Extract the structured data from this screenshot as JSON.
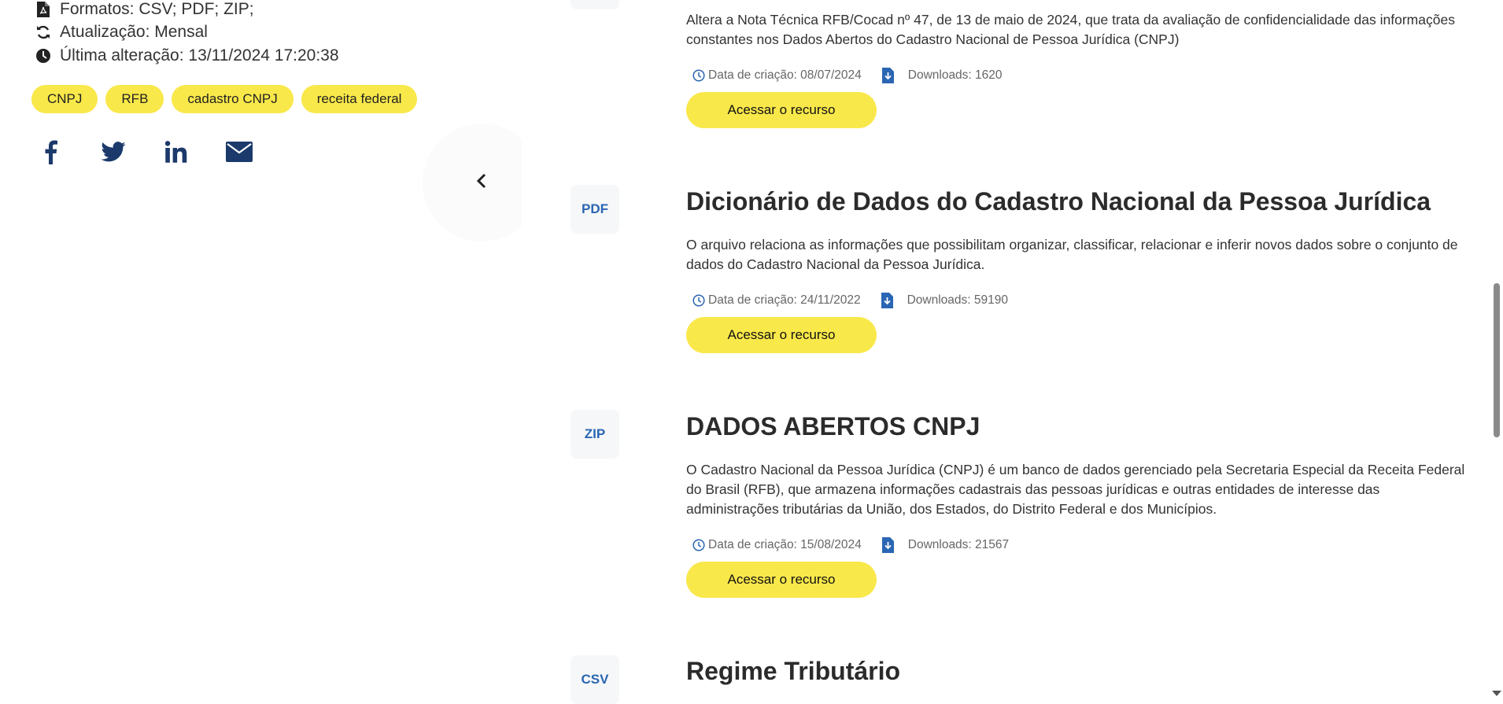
{
  "sidebar": {
    "formats": "Formatos: CSV; PDF; ZIP;",
    "update": "Atualização: Mensal",
    "last_change": "Última alteração: 13/11/2024 17:20:38",
    "tags": [
      "CNPJ",
      "RFB",
      "cadastro CNPJ",
      "receita federal"
    ],
    "social": [
      "facebook-icon",
      "twitter-icon",
      "linkedin-icon",
      "email-icon"
    ]
  },
  "resources": [
    {
      "format": "",
      "title": "",
      "description": "Altera a Nota Técnica RFB/Cocad nº 47, de 13 de maio de 2024, que trata da avaliação de confidencialidade das informações constantes nos Dados Abertos do Cadastro Nacional de Pessoa Jurídica (CNPJ)",
      "created": "Data de criação: 08/07/2024",
      "downloads": "Downloads: 1620",
      "button": "Acessar o recurso"
    },
    {
      "format": "PDF",
      "title": "Dicionário de Dados do Cadastro Nacional da Pessoa Jurídica",
      "description": "O arquivo relaciona as informações que possibilitam organizar, classificar, relacionar e inferir novos dados sobre o conjunto de dados do Cadastro Nacional da Pessoa Jurídica.",
      "created": "Data de criação: 24/11/2022",
      "downloads": "Downloads: 59190",
      "button": "Acessar o recurso"
    },
    {
      "format": "ZIP",
      "title": "DADOS ABERTOS CNPJ",
      "description": "O Cadastro Nacional da Pessoa Jurídica (CNPJ) é um banco de dados gerenciado pela Secretaria Especial da Receita Federal do Brasil (RFB), que armazena informações cadastrais das pessoas jurídicas e outras entidades de interesse das administrações tributárias da União, dos Estados, do Distrito Federal e dos Municípios.",
      "created": "Data de criação: 15/08/2024",
      "downloads": "Downloads: 21567",
      "button": "Acessar o recurso"
    },
    {
      "format": "CSV",
      "title": "Regime Tributário"
    }
  ],
  "colors": {
    "accent": "#f9e84a",
    "format_text": "#2a66b3",
    "icon_blue": "#2a66b3",
    "social_blue": "#1b3a6b"
  }
}
